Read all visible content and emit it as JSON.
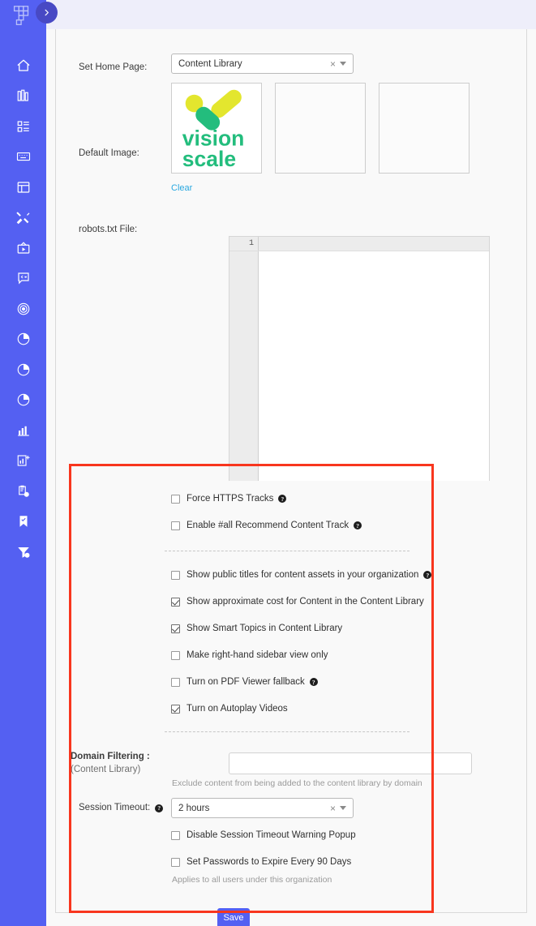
{
  "app": {
    "brand_color": "#5460f2",
    "accent_color": "#4849c4",
    "highlight_color": "#f8361e",
    "link_color": "#29a8e0"
  },
  "sidebar": {
    "logo_name": "app-logo",
    "toggle_label": "›",
    "items": [
      {
        "name": "sidebar-item-home",
        "icon": "home-icon"
      },
      {
        "name": "sidebar-item-library",
        "icon": "books-icon"
      },
      {
        "name": "sidebar-item-dashboard",
        "icon": "grid-list-icon"
      },
      {
        "name": "sidebar-item-keyboard",
        "icon": "keyboard-icon"
      },
      {
        "name": "sidebar-item-layout",
        "icon": "window-layout-icon"
      },
      {
        "name": "sidebar-item-tools",
        "icon": "tools-icon"
      },
      {
        "name": "sidebar-item-video",
        "icon": "tv-play-icon"
      },
      {
        "name": "sidebar-item-chat",
        "icon": "chat-bubble-icon"
      },
      {
        "name": "sidebar-item-target",
        "icon": "target-icon"
      },
      {
        "name": "sidebar-item-pie-one",
        "icon": "pie-chart-icon"
      },
      {
        "name": "sidebar-item-pie-two",
        "icon": "pie-chart-icon"
      },
      {
        "name": "sidebar-item-pie-three",
        "icon": "pie-chart-icon"
      },
      {
        "name": "sidebar-item-analytics",
        "icon": "bar-chart-icon"
      },
      {
        "name": "sidebar-item-add-report",
        "icon": "chart-plus-icon"
      },
      {
        "name": "sidebar-item-scheduled",
        "icon": "clipboard-clock-icon"
      },
      {
        "name": "sidebar-item-bookmarks",
        "icon": "bookmark-check-icon"
      },
      {
        "name": "sidebar-item-filter",
        "icon": "funnel-dollar-icon"
      }
    ]
  },
  "form": {
    "home_page": {
      "label": "Set Home Page:",
      "value": "Content Library",
      "clear_icon": "×"
    },
    "default_image": {
      "label": "Default Image:",
      "logo_line1": "vision",
      "logo_line2": "scale",
      "clear_label": "Clear",
      "slot_count": 3
    },
    "robots": {
      "label": "robots.txt File:",
      "line_number": "1",
      "content": ""
    },
    "checkbox_groups": [
      {
        "group": "tracking",
        "items": [
          {
            "name": "force-https-tracks",
            "label": "Force HTTPS Tracks",
            "checked": false,
            "help": true
          },
          {
            "name": "enable-all-recommend-content-track",
            "label": "Enable #all Recommend Content Track",
            "checked": false,
            "help": true
          }
        ]
      },
      {
        "group": "content-library",
        "items": [
          {
            "name": "show-public-titles",
            "label": "Show public titles for content assets in your organization",
            "checked": false,
            "help": true
          },
          {
            "name": "show-approximate-cost",
            "label": "Show approximate cost for Content in the Content Library",
            "checked": true,
            "help": false
          },
          {
            "name": "show-smart-topics",
            "label": "Show Smart Topics in Content Library",
            "checked": true,
            "help": false
          },
          {
            "name": "make-right-hand-sidebar-view-only",
            "label": "Make right-hand sidebar view only",
            "checked": false,
            "help": false
          },
          {
            "name": "turn-on-pdf-viewer-fallback",
            "label": "Turn on PDF Viewer fallback",
            "checked": false,
            "help": true
          },
          {
            "name": "turn-on-autoplay-videos",
            "label": "Turn on Autoplay Videos",
            "checked": true,
            "help": false
          }
        ]
      }
    ],
    "domain_filtering": {
      "label": "Domain Filtering :",
      "sublabel": "(Content Library)",
      "value": "",
      "hint": "Exclude content from being added to the content library by domain"
    },
    "session_timeout": {
      "label": "Session Timeout:",
      "value": "2 hours",
      "clear_icon": "×",
      "help": true
    },
    "security_checkboxes": [
      {
        "name": "disable-session-timeout-warning-popup",
        "label": "Disable Session Timeout Warning Popup",
        "checked": false
      },
      {
        "name": "set-passwords-to-expire",
        "label": "Set Passwords to Expire Every 90 Days",
        "checked": false
      }
    ],
    "security_hint": "Applies to all users under this organization",
    "save_label": "Save"
  }
}
